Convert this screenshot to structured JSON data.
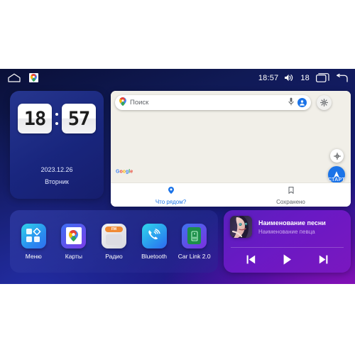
{
  "statusbar": {
    "home_icon": "home-icon",
    "maps_icon": "google-maps-icon",
    "time": "18:57",
    "volume_icon": "volume-icon",
    "volume_level": "18",
    "recents_icon": "recent-apps-icon",
    "back_icon": "back-arrow-icon"
  },
  "clock": {
    "hours": "18",
    "minutes": "57",
    "date": "2023.12.26",
    "weekday": "Вторник"
  },
  "map": {
    "search_placeholder": "Поиск",
    "pin_icon": "map-pin-icon",
    "mic_icon": "microphone-icon",
    "avatar_icon": "account-avatar-icon",
    "layers_icon": "map-layers-icon",
    "locate_icon": "my-location-icon",
    "start_icon": "navigation-arrow-icon",
    "start_label": "СТАРТ",
    "brand": "Google",
    "nav": [
      {
        "label": "Что рядом?",
        "icon": "place-pin-icon",
        "active": true
      },
      {
        "label": "Сохранено",
        "icon": "bookmark-icon",
        "active": false
      }
    ]
  },
  "dock": {
    "apps": [
      {
        "label": "Меню",
        "icon": "apps-grid-icon"
      },
      {
        "label": "Карты",
        "icon": "google-maps-icon"
      },
      {
        "label": "Радио",
        "icon": "fm-radio-icon",
        "band": "FM"
      },
      {
        "label": "Bluetooth",
        "icon": "bluetooth-phone-icon"
      },
      {
        "label": "Car Link 2.0",
        "icon": "car-link-icon"
      }
    ]
  },
  "music": {
    "title": "Наименование песни",
    "artist": "Наименование певца",
    "album_art": "female-portrait-album-art",
    "prev_icon": "previous-track-icon",
    "play_icon": "play-icon",
    "next_icon": "next-track-icon"
  },
  "colors": {
    "accent_blue": "#1a73e8",
    "map_bg": "#f1efe8",
    "music_purple": "#6a19c4",
    "radio_orange": "#f08a35"
  }
}
